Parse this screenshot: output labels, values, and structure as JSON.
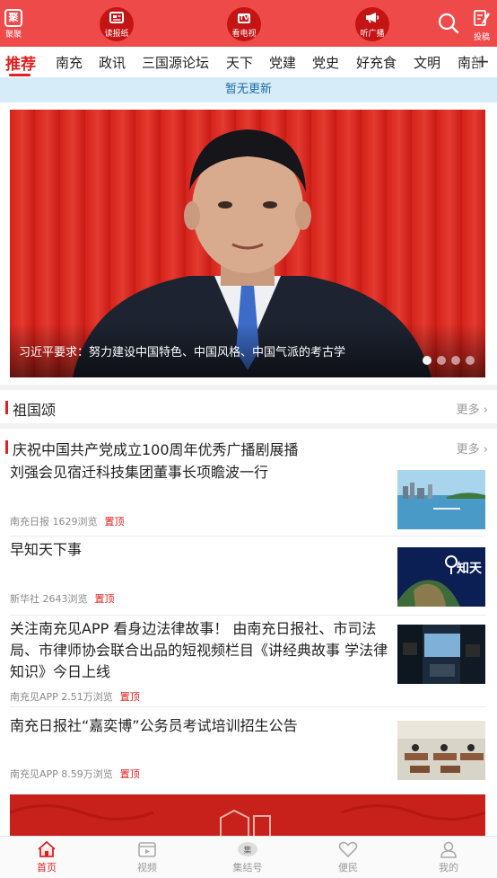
{
  "topbar": {
    "logo_label": "聚聚",
    "circle_buttons": [
      {
        "label": "读报纸",
        "icon": "newspaper-icon"
      },
      {
        "label": "看电视",
        "icon": "tv-icon"
      },
      {
        "label": "听广播",
        "icon": "megaphone-icon"
      }
    ],
    "tv_icon_text": "TV",
    "submit_label": "投稿"
  },
  "tabs": [
    "推荐",
    "南充",
    "政讯",
    "三国源论坛",
    "天下",
    "党建",
    "党史",
    "好充食",
    "文明",
    "南部"
  ],
  "notice": "暂无更新",
  "banner": {
    "caption": "习近平要求：努力建设中国特色、中国风格、中国气派的考古学",
    "slide_count": 4,
    "active_slide": 1
  },
  "sections": [
    {
      "title": "祖国颂",
      "more": "更多"
    },
    {
      "title": "庆祝中国共产党成立100周年优秀广播剧展播",
      "more": "更多"
    }
  ],
  "news": [
    {
      "title": "刘强会见宿迁科技集团董事长项瞻波一行",
      "source": "南充日报",
      "views": "1629浏览",
      "tag": "置顶",
      "thumb": "lake-city-photo"
    },
    {
      "title": "早知天下事",
      "source": "新华社",
      "views": "2643浏览",
      "tag": "置顶",
      "thumb": "earth-map-photo"
    },
    {
      "title": "关注南充见APP 看身边法律故事！ 由南充日报社、市司法局、市律师协会联合出品的短视频栏目《讲经典故事 学法律知识》今日上线",
      "source": "南充见APP",
      "views": "2.51万浏览",
      "tag": "置顶",
      "thumb": "studio-photo"
    },
    {
      "title": "南充日报社“嘉奕博”公务员考试培训招生公告",
      "source": "南充见APP",
      "views": "8.59万浏览",
      "tag": "置顶",
      "thumb": "classroom-photo"
    }
  ],
  "thumb_texts": {
    "earth_label": "知天"
  },
  "bottom_nav": [
    {
      "label": "首页",
      "icon": "home-icon",
      "active": true
    },
    {
      "label": "视频",
      "icon": "video-icon",
      "active": false
    },
    {
      "label": "集结号",
      "icon": "rally-icon",
      "active": false
    },
    {
      "label": "便民",
      "icon": "heart-icon",
      "active": false
    },
    {
      "label": "我的",
      "icon": "person-icon",
      "active": false
    }
  ],
  "colors": {
    "brand_red": "#ef4a4a",
    "accent_red": "#e02020",
    "notice_bg": "#d6ecf9",
    "notice_text": "#1d6aa8"
  }
}
